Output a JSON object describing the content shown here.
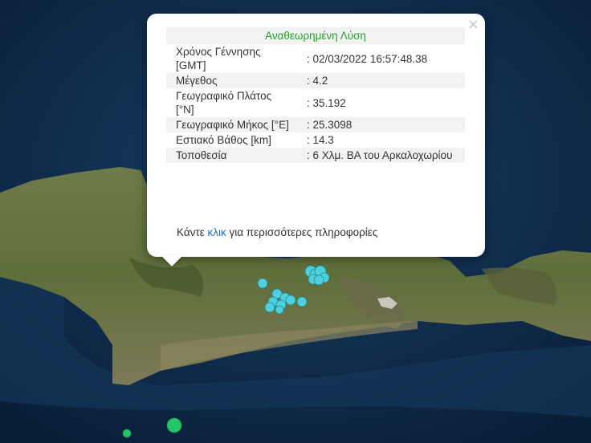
{
  "popup": {
    "close": "×",
    "title": "Αναθεωρημένη Λύση",
    "rows": [
      {
        "label": "Χρόνος Γέννησης [GMT]",
        "value": ": 02/03/2022 16:57:48.38"
      },
      {
        "label": "Μέγεθος",
        "value": ": 4.2"
      },
      {
        "label": "Γεωγραφικό Πλάτος [°N]",
        "value": ": 35.192"
      },
      {
        "label": "Γεωγραφικό Μήκος [°E]",
        "value": ": 25.3098"
      },
      {
        "label": "Εστιακό Βάθος [km]",
        "value": ": 14.3"
      },
      {
        "label": "Τοποθεσία",
        "value": ": 6 Χλμ. ΒΑ του Αρκαλοχωρίου"
      }
    ],
    "more_before": "Κάντε ",
    "more_link": "κλικ",
    "more_after": " για περισσότερες πληροφορίες"
  },
  "colors": {
    "sea": "#0e2a4a",
    "land": "#5b6b3c",
    "marker": "#4fd0dc",
    "marker_green": "#25c66a",
    "title_green": "#22a22a",
    "link": "#1f6fd0"
  }
}
